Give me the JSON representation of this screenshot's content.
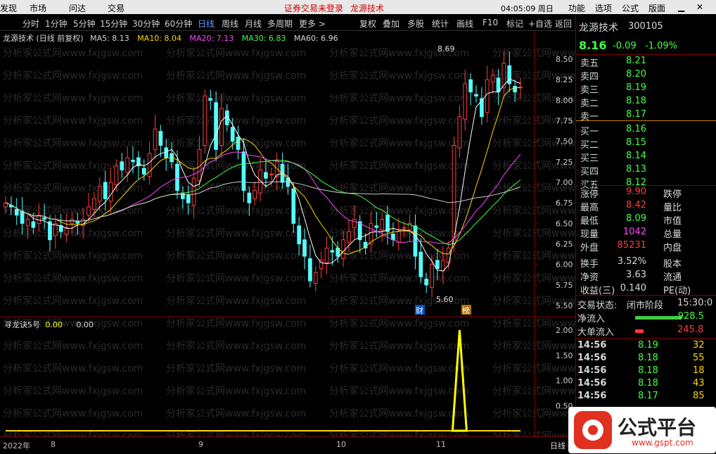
{
  "topbar": {
    "items": [
      "发现",
      "市场",
      "问达",
      "交易"
    ],
    "notice": "证券交易未登录",
    "stock_link": "龙源技术",
    "clock": "04:05:09 周日",
    "menu": [
      "功能",
      "选项",
      "公式",
      "版面"
    ]
  },
  "tabs": {
    "periods": [
      "分时",
      "1分钟",
      "5分钟",
      "15分钟",
      "30分钟",
      "60分钟",
      "日线",
      "周线",
      "月线",
      "多周期",
      "更多 >"
    ],
    "active": "日线",
    "tools": [
      "复权",
      "叠加",
      "多股",
      "统计",
      "画线",
      "F10",
      "标记",
      "+自选",
      "返回"
    ]
  },
  "legend": {
    "title": "龙源技术 (日线 前复权)",
    "ma5": "MA5: 8.13",
    "ma10": "MA10: 8.04",
    "ma20": "MA20: 7.13",
    "ma30": "MA30: 6.83",
    "ma60": "MA60: 6.96"
  },
  "colors": {
    "up": "#ff3c3c",
    "down": "#54ffff",
    "ma5": "#ffffff",
    "ma10": "#ffd700",
    "ma20": "#ff44ff",
    "ma30": "#44ff44",
    "ma60": "#c8c8c8",
    "accent": "#800000"
  },
  "chart_data": {
    "type": "candlestick",
    "y_axis_ticks": [
      "8.50",
      "8.25",
      "8.00",
      "7.75",
      "7.50",
      "7.25",
      "7.00",
      "6.75",
      "6.50",
      "6.25",
      "6.00",
      "5.75",
      "5.50"
    ],
    "ylim": [
      5.5,
      8.5
    ],
    "x_labels": [
      "2022年",
      "8",
      "9",
      "10",
      "11"
    ],
    "annotations": {
      "high_label": "8.69",
      "low_label": "5.60",
      "badge1": "财",
      "badge2": "榜"
    },
    "closes": [
      6.75,
      6.7,
      6.6,
      6.5,
      6.55,
      6.45,
      6.6,
      6.55,
      6.3,
      6.5,
      6.4,
      6.45,
      6.55,
      6.5,
      6.55,
      6.7,
      6.8,
      6.95,
      6.8,
      7.0,
      7.2,
      7.15,
      7.3,
      7.25,
      7.2,
      7.1,
      7.35,
      7.65,
      7.45,
      7.3,
      7.25,
      6.9,
      6.8,
      6.75,
      7.05,
      7.4,
      8.05,
      8.0,
      7.4,
      7.9,
      7.7,
      7.5,
      7.4,
      6.9,
      6.75,
      6.9,
      7.15,
      7.05,
      7.1,
      7.25,
      7.0,
      6.95,
      6.5,
      6.25,
      6.1,
      5.8,
      5.9,
      6.05,
      6.2,
      6.15,
      6.1,
      6.3,
      6.4,
      6.55,
      6.3,
      6.2,
      6.5,
      6.45,
      6.55,
      6.4,
      6.3,
      6.4,
      6.45,
      6.5,
      6.1,
      5.85,
      5.75,
      6.0,
      5.95,
      6.05,
      6.2,
      7.45,
      7.8,
      8.2,
      8.1,
      8.05,
      7.8,
      8.25,
      8.3,
      8.1,
      8.45,
      8.2,
      8.1,
      8.16
    ],
    "indicator": {
      "name": "寻龙诀5号",
      "value": "0.00",
      "value2": "0.00",
      "y_ticks": [
        "2.00",
        "1.50",
        "1.00",
        "0.50"
      ],
      "ylim": [
        0,
        2
      ],
      "spike_index": 82,
      "spike_value": 2.0
    }
  },
  "quote": {
    "name": "龙源技术",
    "code": "300105",
    "price": "8.16",
    "change": "-0.09",
    "change_pct": "-1.09%",
    "asks": [
      {
        "label": "卖五",
        "price": "8.21"
      },
      {
        "label": "卖四",
        "price": "8.20"
      },
      {
        "label": "卖三",
        "price": "8.19"
      },
      {
        "label": "卖二",
        "price": "8.18"
      },
      {
        "label": "卖一",
        "price": "8.17"
      }
    ],
    "bids": [
      {
        "label": "买一",
        "price": "8.16"
      },
      {
        "label": "买二",
        "price": "8.15"
      },
      {
        "label": "买三",
        "price": "8.14"
      },
      {
        "label": "买四",
        "price": "8.13"
      },
      {
        "label": "买五",
        "price": "8.12"
      }
    ],
    "stats": [
      {
        "label": "涨停",
        "value": "9.90",
        "right": "跌停",
        "color": "#ff3c3c"
      },
      {
        "label": "最高",
        "value": "8.42",
        "right": "量比",
        "color": "#ff3c3c"
      },
      {
        "label": "最低",
        "value": "8.09",
        "right": "市值",
        "color": "#44ff44"
      },
      {
        "label": "现量",
        "value": "1042",
        "right": "总量",
        "color": "#ff44ff"
      },
      {
        "label": "外盘",
        "value": "85231",
        "right": "内盘",
        "color": "#ff3c3c"
      },
      {
        "label": "换手",
        "value": "3.52%",
        "right": "股本",
        "color": "#d8d8d8"
      },
      {
        "label": "净资",
        "value": "3.63",
        "right": "流通",
        "color": "#d8d8d8"
      },
      {
        "label": "收益(三)",
        "value": "0.140",
        "right": "PE(动)",
        "color": "#d8d8d8"
      }
    ],
    "trade_state_label": "交易状态:",
    "trade_state": "闭市阶段",
    "trade_time": "15:30:0",
    "netflow_label": "净流入",
    "netflow": "-928.5",
    "bigflow_label": "大单流入",
    "bigflow": "245.8",
    "ticks": [
      {
        "time": "14:56",
        "price": "8.19",
        "vol": "32"
      },
      {
        "time": "14:56",
        "price": "8.18",
        "vol": "55"
      },
      {
        "time": "14:56",
        "price": "8.18",
        "vol": "18"
      },
      {
        "time": "14:56",
        "price": "8.18",
        "vol": "43"
      },
      {
        "time": "14:56",
        "price": "8.17",
        "vol": "85"
      }
    ]
  },
  "bottom": {
    "label": "日线"
  },
  "logo": {
    "title": "公式平台",
    "url": "www.gspt.com"
  },
  "watermark": "分析家公式网www.fxjgsw.com"
}
